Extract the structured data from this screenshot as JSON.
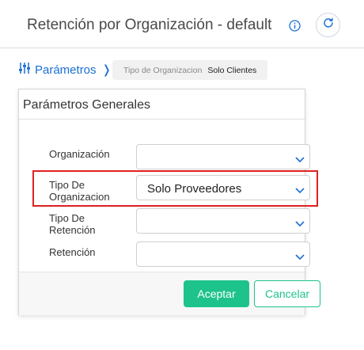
{
  "header": {
    "title": "Retención por Organización - default",
    "info_icon": "info-circle-icon",
    "refresh_icon": "refresh-icon"
  },
  "filter_bar": {
    "params_label": "Parámetros",
    "params_icon": "sliders-icon",
    "chevron": "❭",
    "chip_key": "Tipo de Organizacion",
    "chip_value": "Solo Clientes"
  },
  "panel": {
    "title": "Parámetros Generales",
    "fields": [
      {
        "label": "Organización",
        "value": ""
      },
      {
        "label": "Tipo De Organizacion",
        "value": "Solo Proveedores"
      },
      {
        "label": "Tipo De Retención",
        "value": ""
      },
      {
        "label": "Retención",
        "value": ""
      }
    ],
    "accept_label": "Aceptar",
    "cancel_label": "Cancelar"
  },
  "colors": {
    "accent_blue": "#1a6fd4",
    "accept_green": "#1ec38c",
    "highlight_red": "#e02020"
  }
}
